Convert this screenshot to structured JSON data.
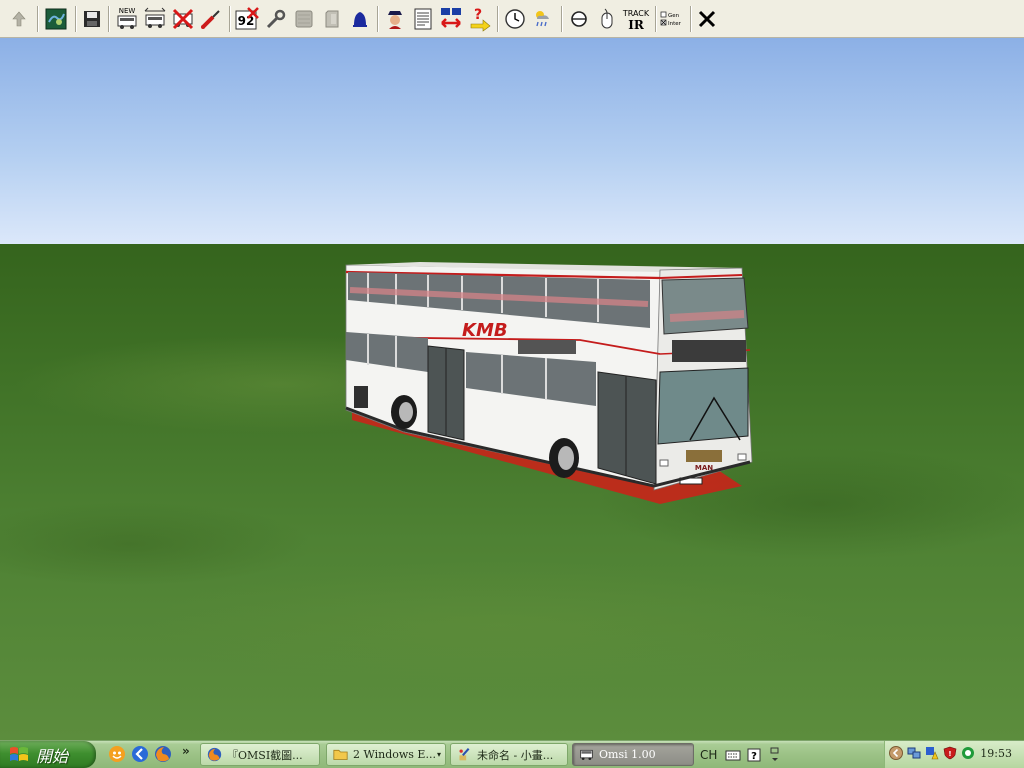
{
  "toolbar": {
    "items": [
      {
        "name": "up-arrow-icon"
      },
      {
        "name": "map-icon"
      },
      {
        "name": "save-icon"
      },
      {
        "name": "new-bus-icon",
        "label": "NEW"
      },
      {
        "name": "bus-replace-icon"
      },
      {
        "name": "remove-bus-icon"
      },
      {
        "name": "eyedropper-icon"
      },
      {
        "name": "route-number-icon",
        "label": "92"
      },
      {
        "name": "wrench-icon"
      },
      {
        "name": "ticket-icon"
      },
      {
        "name": "ticket-stub-icon"
      },
      {
        "name": "bell-icon"
      },
      {
        "name": "driver-icon"
      },
      {
        "name": "timetable-icon"
      },
      {
        "name": "bus-exchange-icon"
      },
      {
        "name": "help-arrow-icon"
      },
      {
        "name": "clock-icon"
      },
      {
        "name": "weather-icon"
      },
      {
        "name": "camera-icon"
      },
      {
        "name": "mouse-icon"
      },
      {
        "name": "trackir-icon",
        "label_top": "TRACK",
        "label_bottom": "IR"
      },
      {
        "name": "checkbox-options-icon",
        "line1": "Gen",
        "line2": "Inter"
      },
      {
        "name": "close-icon"
      }
    ]
  },
  "scene": {
    "bus_logo": "KMB",
    "bus_make": "MAN"
  },
  "taskbar": {
    "start_label": "開始",
    "quicklaunch": [
      {
        "name": "messenger-icon"
      },
      {
        "name": "browser-back-icon"
      },
      {
        "name": "firefox-icon"
      }
    ],
    "chevron": "»",
    "tasks": [
      {
        "name": "task-firefox",
        "label": "『OMSI截圖...",
        "active": false
      },
      {
        "name": "task-windows-explorer",
        "label": "2 Windows E...",
        "active": false,
        "caret": "▾"
      },
      {
        "name": "task-paint",
        "label": "未命名 - 小畫...",
        "active": false
      },
      {
        "name": "task-omsi",
        "label": "Omsi 1.00",
        "active": true
      }
    ],
    "language": "CH",
    "clock": "19:53"
  }
}
